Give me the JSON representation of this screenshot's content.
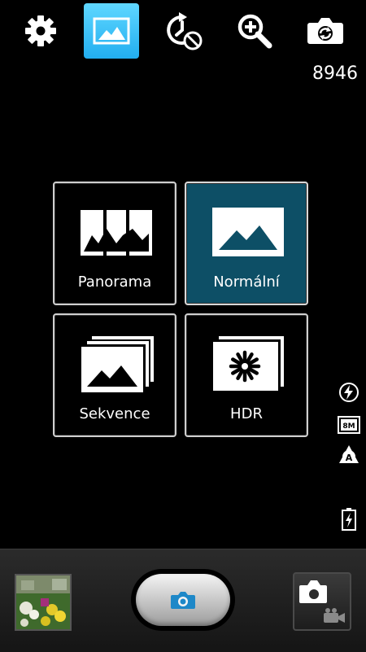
{
  "topbar": {
    "icons": [
      "gear-icon",
      "image-mode-icon",
      "timer-off-icon",
      "zoom-in-icon",
      "switch-camera-icon"
    ],
    "accent": "#2cb7f5"
  },
  "counter": "8946",
  "modes": {
    "panorama": "Panorama",
    "normal": "Normální",
    "sequence": "Sekvence",
    "hdr": "HDR"
  },
  "selected_mode": "Normální",
  "selected_color": "#0d4f66",
  "side_indicators": [
    "flash-auto-icon",
    "resolution-8m-icon",
    "auto-scene-icon",
    "battery-charging-icon"
  ],
  "side_labels": {
    "resolution": "8M",
    "auto": "A"
  },
  "bottombar": {
    "icons": [
      "gallery-thumbnail",
      "shutter-camera-icon",
      "camera-video-switch-icon"
    ]
  }
}
